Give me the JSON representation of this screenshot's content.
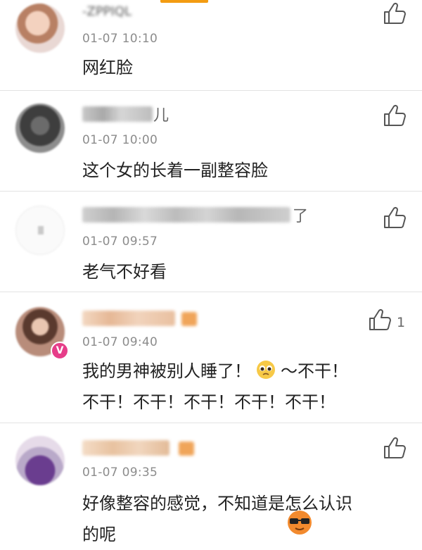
{
  "colors": {
    "accent": "#f39c12",
    "divider": "#e3e3e3",
    "time_gray": "#8c8c8c",
    "vip_pink": "#e63d89"
  },
  "comments": [
    {
      "name": "-ZPPIQL",
      "time": "01-07 10:10",
      "text": "网红脸",
      "likes": ""
    },
    {
      "name": "",
      "name_tail": "儿",
      "time": "01-07 10:00",
      "text": "这个女的长着一副整容脸",
      "likes": ""
    },
    {
      "name": "",
      "name_tail": "了",
      "time": "01-07 09:57",
      "text": "老气不好看",
      "likes": ""
    },
    {
      "name": "",
      "time": "01-07 09:40",
      "text": "我的男神被别人睡了！",
      "text_after_emoji": "～不干！",
      "text_line2": "不干！不干！不干！不干！不干！",
      "likes": "1",
      "emoji": "pleading-face-icon"
    },
    {
      "name": "",
      "time": "01-07 09:35",
      "text": "好像整容的感觉，不知道是怎么认识",
      "text_line2": "的呢",
      "likes": ""
    }
  ],
  "icons": {
    "like": "thumbs-up-icon",
    "vip": "vip-badge-icon",
    "watermark": "sunglasses-mascot-icon"
  },
  "vip_label": "V"
}
